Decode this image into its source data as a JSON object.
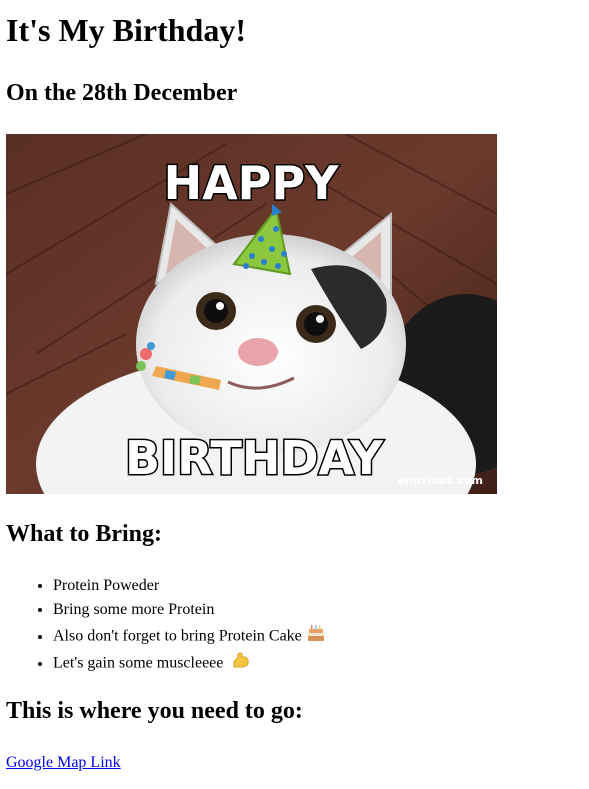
{
  "page": {
    "title": "It's My Birthday!",
    "date_heading": "On the 28th December"
  },
  "hero_image": {
    "caption_top": "HAPPY",
    "caption_bottom": "BIRTHDAY",
    "watermark": "enoxious.com",
    "alt": "Happy birthday cat meme with party hat and party horn"
  },
  "bring": {
    "heading": "What to Bring:",
    "items": [
      {
        "text": "Protein Poweder",
        "icon": ""
      },
      {
        "text": "Bring some more Protein",
        "icon": ""
      },
      {
        "text": "Also don't forget to bring Protein Cake",
        "icon": "cake-icon"
      },
      {
        "text": "Let's gain some muscleeee",
        "icon": "flexed-biceps-icon"
      }
    ]
  },
  "location": {
    "heading": "This is where you need to go:",
    "link_text": "Google Map Link"
  },
  "colors": {
    "link": "#0000ee",
    "text": "#000000"
  }
}
